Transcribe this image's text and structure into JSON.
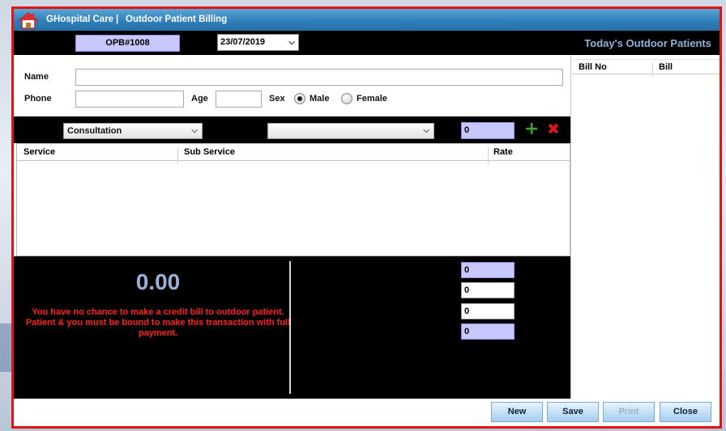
{
  "window": {
    "app_name": "GHospital Care",
    "separator": "|",
    "module_title": "Outdoor Patient Billing"
  },
  "topbar": {
    "bill_no": "OPB#1008",
    "date": "23/07/2019",
    "today_title": "Today's Outdoor Patients"
  },
  "form": {
    "name_label": "Name",
    "name_value": "",
    "phone_label": "Phone",
    "phone_value": "",
    "age_label": "Age",
    "age_value": "",
    "sex_label": "Sex",
    "sex_options": [
      "Male",
      "Female"
    ],
    "sex_selected": "Male"
  },
  "service_bar": {
    "service_select": "Consultation",
    "sub_service_select": "",
    "rate_value": "0"
  },
  "service_table": {
    "columns": [
      "Service",
      "Sub Service",
      "Rate"
    ],
    "rows": []
  },
  "summary": {
    "total": "0.00",
    "warning": "You have no chance to make a credit bill to outdoor patient. Patient & you must be bound to make this transaction with full payment.",
    "fields": [
      "0",
      "0",
      "0",
      "0"
    ]
  },
  "today_table": {
    "columns": [
      "Bill No",
      "Bill"
    ],
    "rows": []
  },
  "footer": {
    "new_label": "New",
    "save_label": "Save",
    "print_label": "Print",
    "close_label": "Close"
  },
  "colors": {
    "title_gradient": "#2f7fb9",
    "window_border": "#e51212",
    "highlight_field": "#c8c8ff",
    "total_text": "#9bb0d6",
    "warning_text": "#ff2020",
    "today_title": "#8fb2db"
  }
}
